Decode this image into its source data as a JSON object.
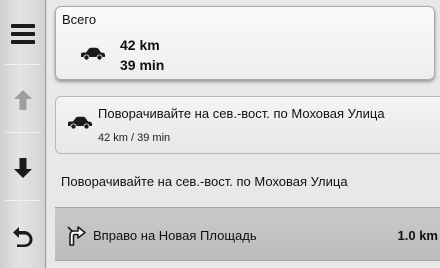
{
  "sidebar": {
    "menu_icon": "menu-icon",
    "up_icon": "arrow-up-icon",
    "down_icon": "arrow-down-icon",
    "back_icon": "back-icon"
  },
  "summary": {
    "title": "Всего",
    "distance": "42 km",
    "time": "39 min"
  },
  "instruction": {
    "text": "Поворачивайте на сев.-вост. по Моховая Улица",
    "sub": "42 km / 39 min"
  },
  "step_detail": "Поворачивайте на сев.-вост. по Моховая Улица",
  "turn": {
    "text": "Вправо на Новая Площадь",
    "distance": "1.0 km"
  },
  "colors": {
    "sidebar": "#d8d8d8",
    "background": "#e8e8e8",
    "highlight_row": "#c4c4c4"
  }
}
